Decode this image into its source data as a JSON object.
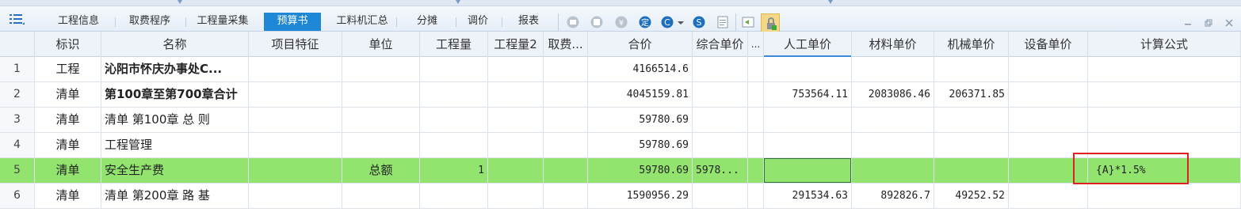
{
  "tabs": [
    {
      "label": "工程信息"
    },
    {
      "label": "取费程序"
    },
    {
      "label": "工程量采集"
    },
    {
      "label": "预算书"
    },
    {
      "label": "工料机汇总"
    },
    {
      "label": "分摊"
    },
    {
      "label": "调价"
    },
    {
      "label": "报表"
    }
  ],
  "active_tab": "预算书",
  "columns": {
    "biaoshi": "标识",
    "mingcheng": "名称",
    "xiangmutezheng": "项目特征",
    "danwei": "单位",
    "gongchengliang": "工程量",
    "gongchengliang2": "工程量2",
    "qufei": "取费...",
    "hejia": "合价",
    "zonghedanjia": "综合单价",
    "extra": "...",
    "rengongdanjia": "人工单价",
    "cailiaodanjia": "材料单价",
    "jixiedanjia": "机械单价",
    "shebeidanjia": "设备单价",
    "jisuangongshi": "计算公式"
  },
  "rows": [
    {
      "no": "1",
      "biaoshi": "工程",
      "mingcheng": "沁阳市怀庆办事处C...",
      "danwei": "",
      "gongchengliang": "",
      "hejia": "4166514.6",
      "zonghedanjia": "",
      "rengong": "",
      "cailiao": "",
      "jixie": "",
      "gongshi": ""
    },
    {
      "no": "2",
      "biaoshi": "清单",
      "mingcheng": "第100章至第700章合计",
      "danwei": "",
      "gongchengliang": "",
      "hejia": "4045159.81",
      "zonghedanjia": "",
      "rengong": "753564.11",
      "cailiao": "2083086.46",
      "jixie": "206371.85",
      "gongshi": ""
    },
    {
      "no": "3",
      "biaoshi": "清单",
      "mingcheng": "清单  第100章  总 则",
      "danwei": "",
      "gongchengliang": "",
      "hejia": "59780.69",
      "zonghedanjia": "",
      "rengong": "",
      "cailiao": "",
      "jixie": "",
      "gongshi": ""
    },
    {
      "no": "4",
      "biaoshi": "清单",
      "mingcheng": "工程管理",
      "danwei": "",
      "gongchengliang": "",
      "hejia": "59780.69",
      "zonghedanjia": "",
      "rengong": "",
      "cailiao": "",
      "jixie": "",
      "gongshi": ""
    },
    {
      "no": "5",
      "biaoshi": "清单",
      "mingcheng": "安全生产费",
      "danwei": "总额",
      "gongchengliang": "1",
      "hejia": "59780.69",
      "zonghedanjia": "5978...",
      "rengong": "",
      "cailiao": "",
      "jixie": "",
      "gongshi": "{A}*1.5%"
    },
    {
      "no": "6",
      "biaoshi": "清单",
      "mingcheng": "清单  第200章  路 基",
      "danwei": "",
      "gongchengliang": "",
      "hejia": "1590956.29",
      "zonghedanjia": "",
      "rengong": "291534.63",
      "cailiao": "892826.7",
      "jixie": "49252.52",
      "gongshi": ""
    }
  ],
  "colors": {
    "active_tab": "#1e88d6",
    "selected_row": "#92e46f",
    "highlight_box": "#e02020"
  },
  "icons": [
    "list-menu-icon",
    "tool-a-icon",
    "tool-b-icon",
    "tool-c-icon",
    "settle-icon",
    "c-dropdown-icon",
    "s-icon",
    "document-icon",
    "import-icon",
    "lock-icon"
  ]
}
